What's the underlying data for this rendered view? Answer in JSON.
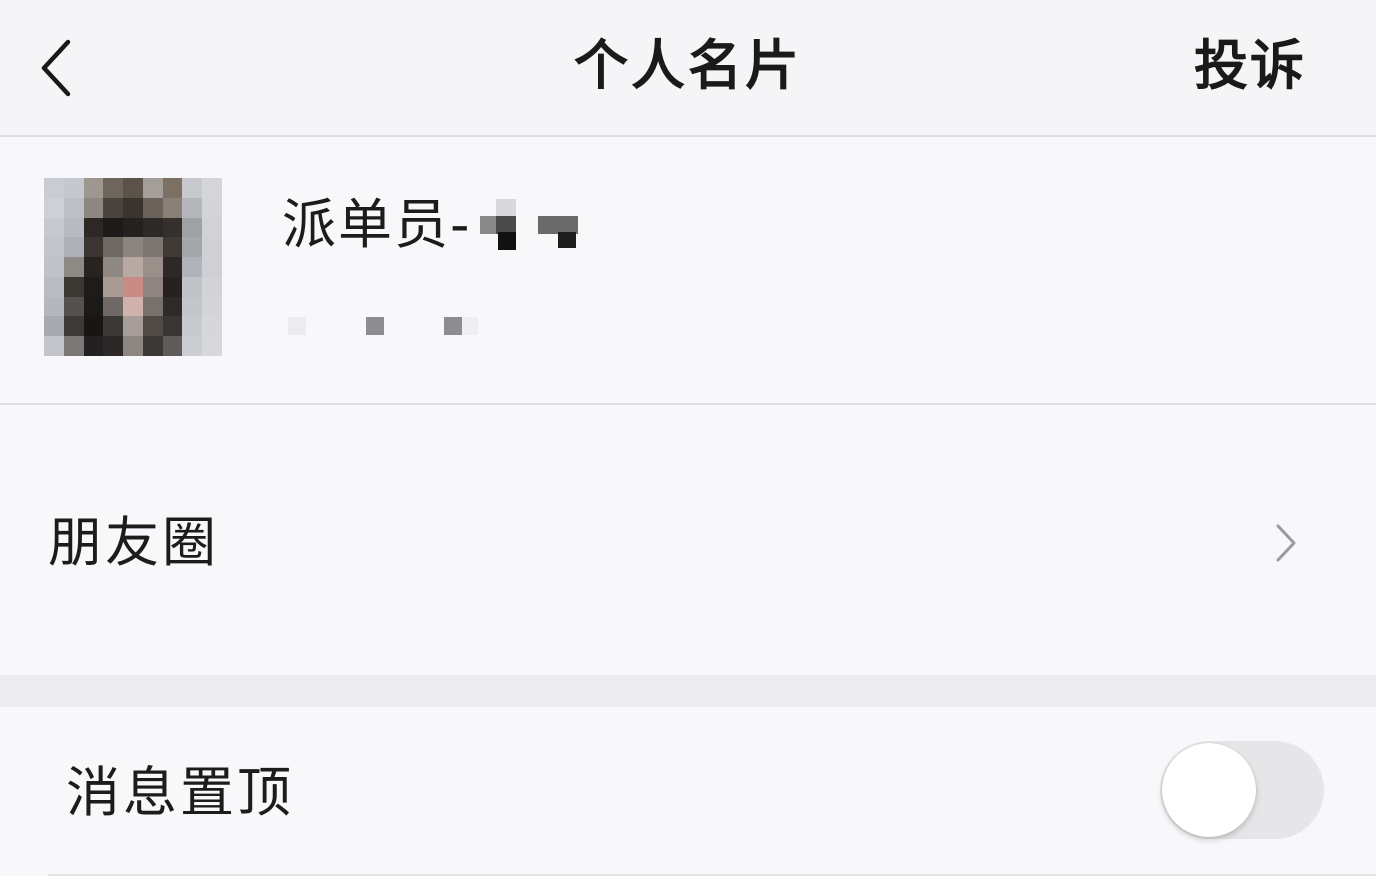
{
  "navbar": {
    "title": "个人名片",
    "complain_label": "投诉",
    "back_icon": "chevron-left-icon"
  },
  "profile": {
    "nickname_visible_prefix": "派单员-",
    "nickname_rest": "redacted-mosaic",
    "id_text": "redacted-mosaic",
    "avatar": "pixelated-avatar"
  },
  "moments": {
    "label": "朋友圈",
    "chevron_icon": "chevron-right-icon"
  },
  "pin_chat": {
    "label": "消息置顶",
    "toggle_on": false
  },
  "colors": {
    "background": "#f7f7fa",
    "navbar": "#f5f5f7",
    "text": "#1c1c1c",
    "divider": "#e0e0e4",
    "section_gap": "#ececef",
    "toggle_off_track": "#e6e6e9",
    "toggle_knob": "#ffffff"
  }
}
